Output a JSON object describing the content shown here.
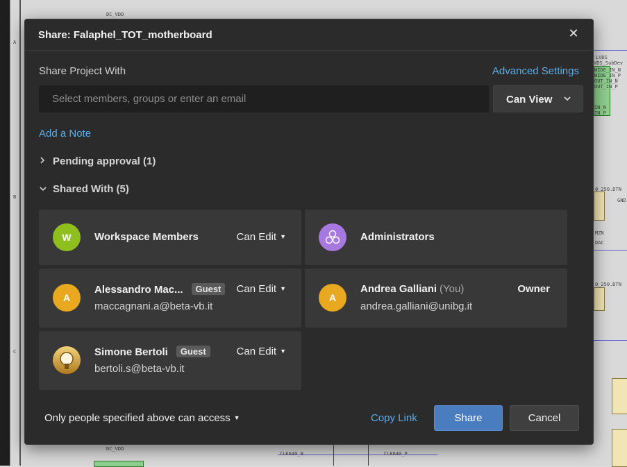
{
  "background": {
    "labels": [
      "DC_VDD",
      "LVDS",
      "VDS_SubDev",
      "WIDE_IN_N",
      "WIDE_IN_P",
      "OUT_IN_N",
      "OUT_IN_P",
      "IN_N",
      "IN_P",
      "0_250.DTN",
      "GND",
      "MZN",
      "DAC",
      "0_250.DTN",
      "CLK640_N",
      "CLK640_P",
      "DC_VDD",
      "A",
      "B",
      "C"
    ]
  },
  "dialog": {
    "title": "Share: Falaphel_TOT_motherboard",
    "close_label": "✕",
    "share_with_label": "Share Project With",
    "advanced_settings": "Advanced Settings",
    "invite_placeholder": "Select members, groups or enter an email",
    "invite_value": "",
    "permission_select": "Can View",
    "add_note": "Add a Note",
    "pending": {
      "label": "Pending approval (1)",
      "arrow": "›",
      "expanded": false
    },
    "shared": {
      "label": "Shared With (5)",
      "arrow": "⌄",
      "expanded": true
    },
    "members": [
      {
        "name": "Workspace Members",
        "avatar_letter": "W",
        "avatar_color": "#8fbf1e",
        "role": "Can Edit",
        "email": ""
      },
      {
        "name": "Administrators",
        "avatar_icon": "group-icon",
        "avatar_color": "#a779e0",
        "role": "",
        "email": ""
      },
      {
        "name": "Alessandro Mac...",
        "badge": "Guest",
        "avatar_letter": "A",
        "avatar_color": "#e8a820",
        "role": "Can Edit",
        "email": "maccagnani.a@beta-vb.it"
      },
      {
        "name": "Andrea Galliani",
        "you_tag": "(You)",
        "avatar_letter": "A",
        "avatar_color": "#e8a820",
        "role": "Owner",
        "email": "andrea.galliani@unibg.it"
      },
      {
        "name": "Simone Bertoli",
        "badge": "Guest",
        "avatar_icon": "profile-photo",
        "avatar_color": "#c9922a",
        "role": "Can Edit",
        "email": "bertoli.s@beta-vb.it"
      }
    ],
    "access_scope": "Only people specified above can access",
    "copy_link": "Copy Link",
    "share_button": "Share",
    "cancel_button": "Cancel",
    "accent_color": "#5aaee8",
    "primary_button_color": "#4a7dc0"
  }
}
